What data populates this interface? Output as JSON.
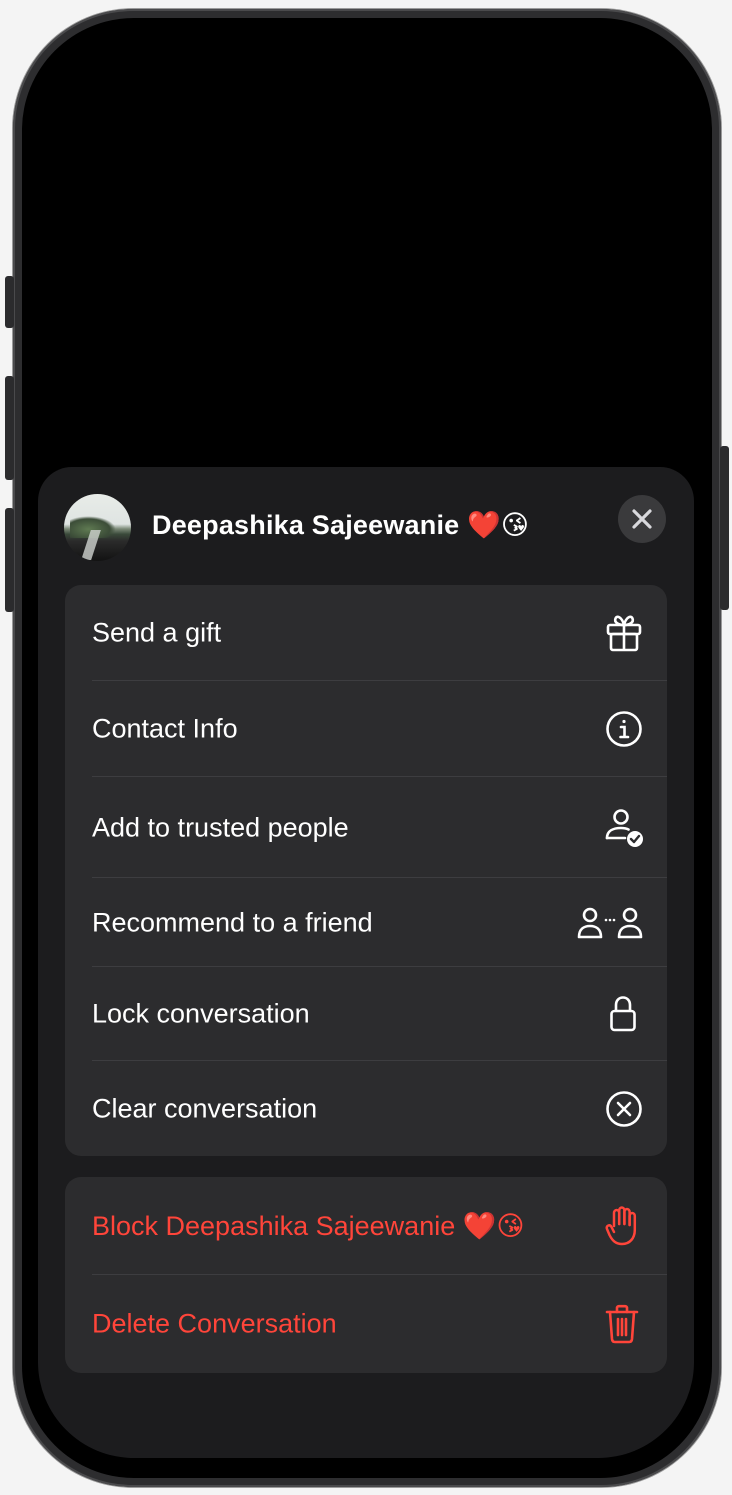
{
  "contact": {
    "name": "Deepashika Sajeewanie ❤️😘"
  },
  "menu_group_1": [
    {
      "label": "Send a gift",
      "icon": "gift-icon"
    },
    {
      "label": "Contact Info",
      "icon": "info-circle-icon"
    },
    {
      "label": "Add to trusted people",
      "icon": "person-checkmark-icon"
    },
    {
      "label": "Recommend to a friend",
      "icon": "people-share-icon"
    },
    {
      "label": "Lock conversation",
      "icon": "lock-icon"
    },
    {
      "label": "Clear conversation",
      "icon": "x-circle-icon"
    }
  ],
  "menu_group_2": [
    {
      "label": "Block Deepashika Sajeewanie ❤️😘",
      "icon": "hand-raised-icon"
    },
    {
      "label": "Delete Conversation",
      "icon": "trash-icon"
    }
  ],
  "colors": {
    "sheet_background": "#1c1c1e",
    "group_background": "#2c2c2e",
    "text_primary": "#ffffff",
    "destructive": "#ff453a",
    "close_button_background": "#3a3a3c"
  }
}
